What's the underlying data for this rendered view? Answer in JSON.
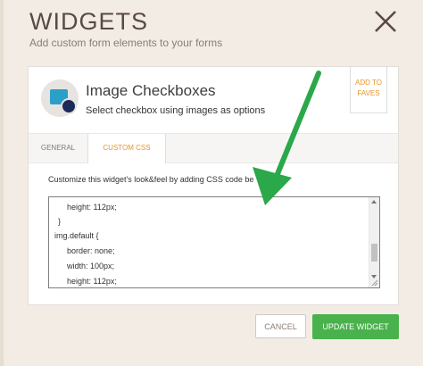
{
  "header": {
    "title": "WIDGETS",
    "subtitle": "Add custom form elements to your forms"
  },
  "widget": {
    "name": "Image Checkboxes",
    "description": "Select checkbox using images as options",
    "add_faves_line1": "ADD TO",
    "add_faves_line2": "FAVES"
  },
  "tabs": [
    {
      "label": "GENERAL",
      "active": false
    },
    {
      "label": "CUSTOM CSS",
      "active": true
    }
  ],
  "editor": {
    "hint": "Customize this widget's look&feel by adding CSS code be",
    "lines": [
      "    height: 112px;",
      "}",
      "img.default {",
      "    border: none;",
      "    width: 100px;",
      "    height: 112px;"
    ]
  },
  "footer": {
    "cancel_label": "CANCEL",
    "update_label": "UPDATE WIDGET"
  },
  "colors": {
    "accent": "#e4962b",
    "primary": "#4ab24c",
    "annotation_arrow": "#2aa84a"
  }
}
